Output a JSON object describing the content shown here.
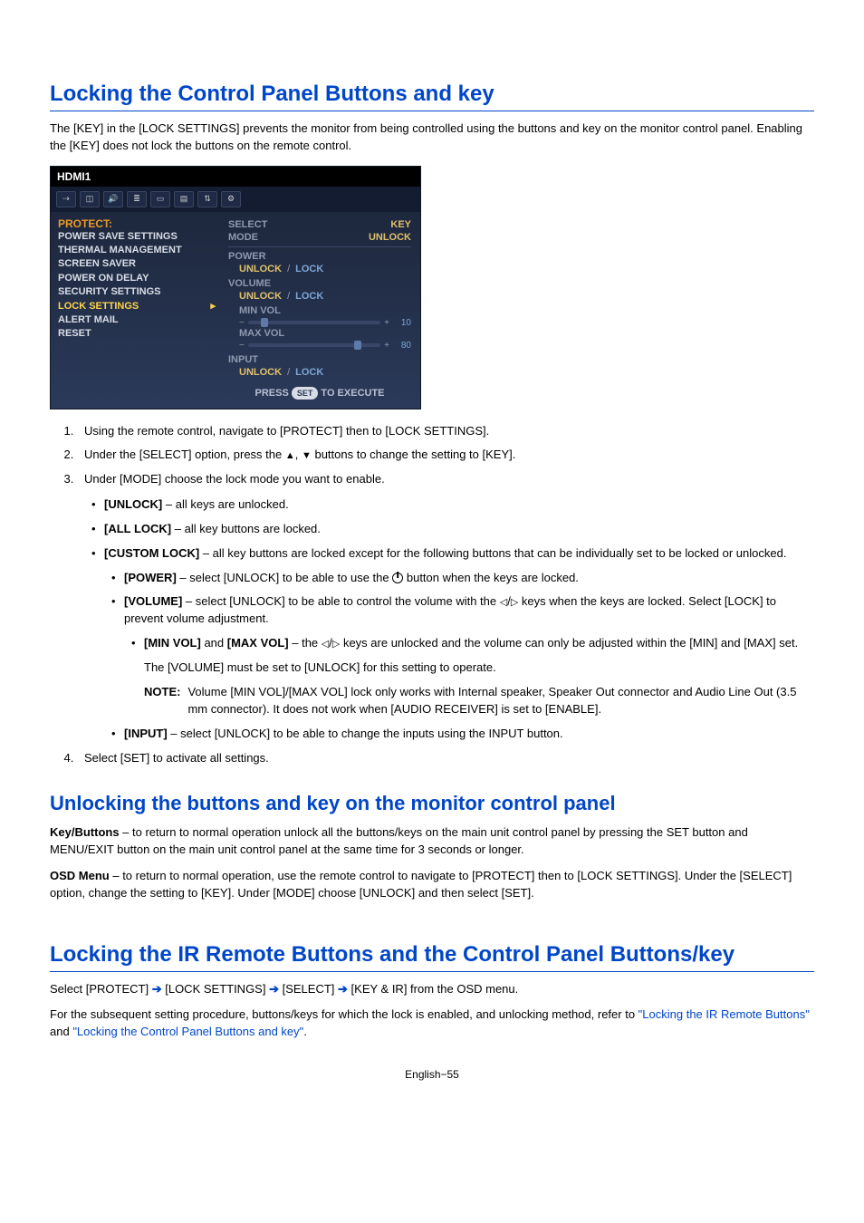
{
  "h1": "Locking the Control Panel Buttons and key",
  "intro": "The [KEY] in the [LOCK SETTINGS] prevents the monitor from being controlled using the buttons and key on the monitor control panel. Enabling the [KEY] does not lock the buttons on the remote control.",
  "osd": {
    "title": "HDMI1",
    "protect": "PROTECT:",
    "left_items": [
      "POWER SAVE SETTINGS",
      "THERMAL MANAGEMENT",
      "SCREEN SAVER",
      "POWER ON DELAY",
      "SECURITY SETTINGS",
      "LOCK SETTINGS",
      "ALERT MAIL",
      "RESET"
    ],
    "select_label": "SELECT",
    "select_value": "KEY",
    "mode_label": "MODE",
    "mode_value": "UNLOCK",
    "power_label": "POWER",
    "power_unlock": "UNLOCK",
    "sep": "/",
    "lock": "LOCK",
    "volume_label": "VOLUME",
    "volume_unlock": "UNLOCK",
    "minvol_label": "MIN VOL",
    "minvol_val_minus": "−",
    "minvol_val_plus": "+",
    "minvol_value": "10",
    "maxvol_label": "MAX VOL",
    "maxvol_value": "80",
    "input_label": "INPUT",
    "input_unlock": "UNLOCK",
    "execute_press": "PRESS",
    "execute_set": "SET",
    "execute_to": "TO EXECUTE"
  },
  "steps": {
    "s1": "Using the remote control, navigate to [PROTECT] then to [LOCK SETTINGS].",
    "s2_pre": "Under the [SELECT] option, press the ",
    "s2_post": " buttons to change the setting to [KEY].",
    "s3": "Under [MODE] choose the lock mode you want to enable.",
    "mode_unlock_b": "[UNLOCK]",
    "mode_unlock_t": " – all keys are unlocked.",
    "mode_all_b": "[ALL LOCK]",
    "mode_all_t": " – all key buttons are locked.",
    "mode_custom_b": "[CUSTOM LOCK]",
    "mode_custom_t": " – all key buttons are locked except for the following buttons that can be individually set to be locked or unlocked.",
    "power_b": "[POWER]",
    "power_t_pre": " – select [UNLOCK] to be able to use the ",
    "power_t_post": " button when the keys are locked.",
    "vol_b": "[VOLUME]",
    "vol_t_pre": " – select [UNLOCK] to be able to control the volume with the ",
    "vol_t_post": " keys when the keys are locked. Select [LOCK] to prevent volume adjustment.",
    "minmax_b1": "[MIN VOL]",
    "minmax_and": " and ",
    "minmax_b2": "[MAX VOL]",
    "minmax_t_pre": " – the ",
    "minmax_t_post": " keys are unlocked and the volume can only be adjusted within the [MIN] and [MAX] set.",
    "minmax_note": "The [VOLUME] must be set to [UNLOCK] for this setting to operate.",
    "note_label": "NOTE:",
    "note_text": "Volume [MIN VOL]/[MAX VOL] lock only works with Internal speaker, Speaker Out connector and Audio Line Out (3.5 mm connector). It does not work when [AUDIO RECEIVER] is set to [ENABLE].",
    "input_b": "[INPUT]",
    "input_t": " – select [UNLOCK] to be able to change the inputs using the INPUT button.",
    "s4": "Select [SET] to activate all settings."
  },
  "h2_unlock": "Unlocking the buttons and key on the monitor control panel",
  "unlock_p1_b": "Key/Buttons",
  "unlock_p1_t": " – to return to normal operation unlock all the buttons/keys on the main unit control panel by pressing the SET button and MENU/EXIT button on the main unit control panel at the same time for 3 seconds or longer.",
  "unlock_p2_b": "OSD Menu",
  "unlock_p2_t": " – to return to normal operation, use the remote control to navigate to [PROTECT] then to [LOCK SETTINGS]. Under the [SELECT] option, change the setting to [KEY]. Under [MODE] choose [UNLOCK] and then select [SET].",
  "h3_lockir": "Locking the IR Remote Buttons and the Control Panel Buttons/key",
  "lockir_p1_pre": "Select [PROTECT] ",
  "lockir_p1_seglock": " [LOCK SETTINGS] ",
  "lockir_p1_segsel": " [SELECT] ",
  "lockir_p1_segkey": " [KEY & IR] from the OSD menu.",
  "lockir_p2_pre": "For the subsequent setting procedure, buttons/keys for which the lock is enabled, and unlocking method, refer to ",
  "lockir_link1": "\"Locking the IR Remote Buttons\"",
  "lockir_and": " and ",
  "lockir_link2": "\"Locking the Control Panel Buttons and key\"",
  "lockir_period": ".",
  "footer": "English−55"
}
